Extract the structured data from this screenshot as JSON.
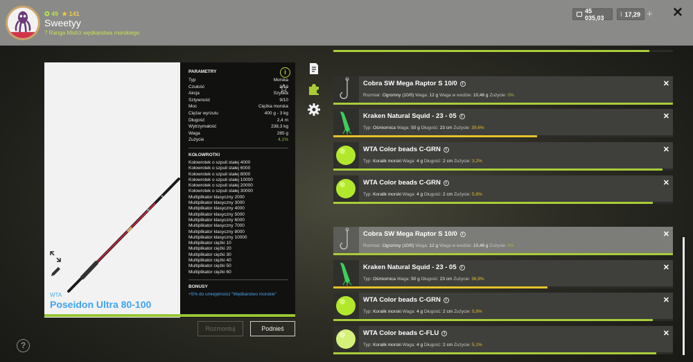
{
  "player": {
    "level": "49",
    "stars": "141",
    "name": "Sweetyy",
    "rank": "7 Ranga Mistrz wędkarstwa morskiego"
  },
  "currency": {
    "silver": "45 035,03",
    "gold": "17,29"
  },
  "rod": {
    "brand": "WTA",
    "name": "Poseidon Ultra 80-100",
    "params_title": "PARAMETRY",
    "params": [
      {
        "label": "Typ",
        "value": "Morska"
      },
      {
        "label": "Czułość",
        "value": "3/10"
      },
      {
        "label": "Akcja",
        "value": "Szybka"
      },
      {
        "label": "Sztywność",
        "value": "9/10"
      },
      {
        "label": "Moc",
        "value": "Ciężka morska"
      },
      {
        "label": "Ciężar wyrzutu",
        "value": "400 g - 3 kg"
      },
      {
        "label": "Długość",
        "value": "2,4 m"
      },
      {
        "label": "Wytrzymałość",
        "value": "238,3 kg"
      },
      {
        "label": "Waga",
        "value": "285 g"
      },
      {
        "label": "Zużycie",
        "value": "4,1%"
      }
    ],
    "reels_title": "KOŁOWROTKI",
    "reels": [
      "Kołowrotek o szpuli stałej 4000",
      "Kołowrotek o szpuli stałej 6000",
      "Kołowrotek o szpuli stałej 8000",
      "Kołowrotek o szpuli stałej 10000",
      "Kołowrotek o szpuli stałej 20000",
      "Kołowrotek o szpuli stałej 30000",
      "Multiplikator klasyczny 2000",
      "Multiplikator klasyczny 3000",
      "Multiplikator klasyczny 4000",
      "Multiplikator klasyczny 5000",
      "Multiplikator klasyczny 6000",
      "Multiplikator klasyczny 7000",
      "Multiplikator klasyczny 8000",
      "Multiplikator klasyczny 10000",
      "Multiplikator ciężki 10",
      "Multiplikator ciężki 20",
      "Multiplikator ciężki 30",
      "Multiplikator ciężki 40",
      "Multiplikator ciężki 50",
      "Multiplikator ciężki 60"
    ],
    "bonus_title": "BONUSY",
    "bonus_text": "+5% do umiejętności \"Wędkarstwo morskie\"",
    "wear_fraction": 1.0
  },
  "buttons": {
    "dismantle": "Rozmontuj",
    "pickup": "Podnieś"
  },
  "items": [
    {
      "title": "Cobra SW Mega Raptor S 10/0",
      "meta": [
        [
          "Rozmiar:",
          "Ogromny (10/0)"
        ],
        [
          "Waga:",
          "12 g"
        ],
        [
          "Waga w wodzie:",
          "10,46 g"
        ]
      ],
      "wear": "0%",
      "wear_color": "green",
      "thumb": "hook",
      "light": false,
      "bar": 1.0,
      "bar_color": "#aacd3a"
    },
    {
      "title": "Kraken Natural Squid - 23 - 05",
      "meta": [
        [
          "Typ:",
          "Ośmiornica"
        ],
        [
          "Waga:",
          "50 g"
        ],
        [
          "Długość:",
          "23 cm"
        ]
      ],
      "wear": "39,6%",
      "wear_color": "yellow",
      "thumb": "squid",
      "light": false,
      "bar": 0.6,
      "bar_color": "#e6c229"
    },
    {
      "title": "WTA Color beads C-GRN",
      "meta": [
        [
          "Typ:",
          "Koralik morski"
        ],
        [
          "Waga:",
          "4 g"
        ],
        [
          "Długość:",
          "2 cm"
        ]
      ],
      "wear": "3,2%",
      "wear_color": "yellow",
      "thumb": "bead",
      "light": false,
      "bar": 0.97,
      "bar_color": "#aacd3a"
    },
    {
      "title": "WTA Color beads C-GRN",
      "meta": [
        [
          "Typ:",
          "Koralik morski"
        ],
        [
          "Waga:",
          "4 g"
        ],
        [
          "Długość:",
          "2 cm"
        ]
      ],
      "wear": "5,8%",
      "wear_color": "yellow",
      "thumb": "bead",
      "light": false,
      "bar": 0.94,
      "bar_color": "#aacd3a"
    },
    {
      "title": "Cobra SW Mega Raptor S 10/0",
      "meta": [
        [
          "Rozmiar:",
          "Ogromny (10/0)"
        ],
        [
          "Waga:",
          "12 g"
        ],
        [
          "Waga w wodzie:",
          "10,46 g"
        ]
      ],
      "wear": "0%",
      "wear_color": "green",
      "thumb": "hook",
      "light": true,
      "bar": 1.0,
      "bar_color": "#aacd3a"
    },
    {
      "title": "Kraken Natural Squid - 23 - 05",
      "meta": [
        [
          "Typ:",
          "Ośmiornica"
        ],
        [
          "Waga:",
          "50 g"
        ],
        [
          "Długość:",
          "23 cm"
        ]
      ],
      "wear": "36,9%",
      "wear_color": "yellow",
      "thumb": "squid",
      "light": false,
      "bar": 0.63,
      "bar_color": "#e6c229"
    },
    {
      "title": "WTA Color beads C-GRN",
      "meta": [
        [
          "Typ:",
          "Koralik morski"
        ],
        [
          "Waga:",
          "4 g"
        ],
        [
          "Długość:",
          "2 cm"
        ]
      ],
      "wear": "5,9%",
      "wear_color": "yellow",
      "thumb": "bead",
      "light": false,
      "bar": 0.94,
      "bar_color": "#aacd3a"
    },
    {
      "title": "WTA Color beads C-FLU",
      "meta": [
        [
          "Typ:",
          "Koralik morski"
        ],
        [
          "Waga:",
          "4 g"
        ],
        [
          "Długość:",
          "2 cm"
        ]
      ],
      "wear": "5,1%",
      "wear_color": "yellow",
      "thumb": "bead_pale",
      "light": false,
      "bar": 0.95,
      "bar_color": "#aacd3a"
    }
  ],
  "wear_label": "Zużycie:",
  "info_glyph": "i"
}
